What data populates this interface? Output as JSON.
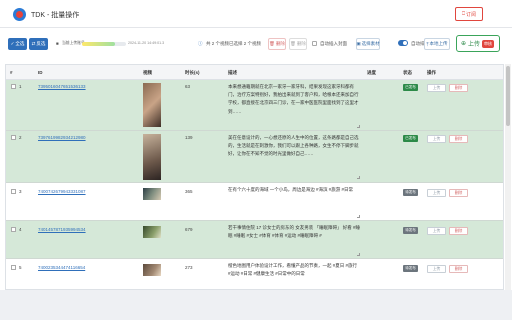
{
  "window": {
    "title": "TDK - 批量操作",
    "subscribe": "订阅"
  },
  "toolbar": {
    "select_all": "全选",
    "invert": "反选",
    "account_label": "当前上传账号",
    "progress_fraction": 0.75,
    "date_info": "2024-11-20 14:49:01.3",
    "count_text": "共 2 个视频已选择 2 个视频",
    "delete": "删除",
    "batch_delete": "删除",
    "auto_insert_label": "自动插入封面",
    "select_cover": "选择素材",
    "auto_sort_label": "自动排序",
    "local_upload": "本地上传",
    "upload": "上传",
    "upload_badge": "审核"
  },
  "table": {
    "headers": [
      "#",
      "ID",
      "视频",
      "时长(s)",
      "描述",
      "进度",
      "状态",
      "操作"
    ],
    "rows": [
      {
        "index": "1",
        "id": "7395016047651536133",
        "duration": "63",
        "status": "已发布",
        "status_kind": "pub",
        "upload": "上传",
        "delete": "删除",
        "desc": "本来想通籍期就在北京一家牙一家牙科，结果发现这家牙科都有门，治疗方案特别好，我拍出来就到了客户和，哈根本还来加自行学校，都直接在北京四三门诊，在一家中医医院里面找到了这里才到……"
      },
      {
        "index": "2",
        "id": "7397619982934212980",
        "duration": "139",
        "status": "已发布",
        "status_kind": "pub",
        "upload": "上传",
        "delete": "删除",
        "desc": "美在任意设计的，一心想还原的人生中的位置，这条路都是自己选的，生活就是在刺激你，我们可以跟上各种路，女生不停下脚步就好，让你在不知不觉的时光里做好自己……"
      },
      {
        "index": "3",
        "id": "7400742679943331087",
        "duration": "365",
        "status": "待发布",
        "status_kind": "pend",
        "upload": "上传",
        "delete": "删除",
        "desc": "在有个六十度的海域 一个小岛，周边是海边 #海滨 #旅游 #日常"
      },
      {
        "index": "4",
        "id": "7401457871935994534",
        "duration": "679",
        "status": "待发布",
        "status_kind": "pend",
        "upload": "上传",
        "delete": "删除",
        "desc": "若干事情住院 17 诊女士的房东的 女友男装 「睡眠障碍」 好看 #睡眠 #睡眠 #女士 #体育 #体育 #运动 #睡眠障碍 #"
      },
      {
        "index": "5",
        "id": "7400235344474116654",
        "duration": "273",
        "status": "待发布",
        "status_kind": "pend",
        "upload": "上传",
        "delete": "删除",
        "desc": "橙色地图用户体验设计工作，看懂产品的节奏，一起 #夏日 #旅行 #运动 #日常 #健康生活 #日常中的日常"
      }
    ]
  },
  "colors": {
    "primary": "#2f6fba",
    "published": "#2c8a48",
    "pending": "#6c757d",
    "danger": "#e0463e",
    "row_highlight": "#d5e8d8"
  },
  "icons": [
    "app-logo-icon",
    "bookmark-icon",
    "info-icon",
    "trash-icon",
    "image-icon",
    "upload-icon",
    "cloud-upload-icon",
    "checkbox-icon"
  ]
}
